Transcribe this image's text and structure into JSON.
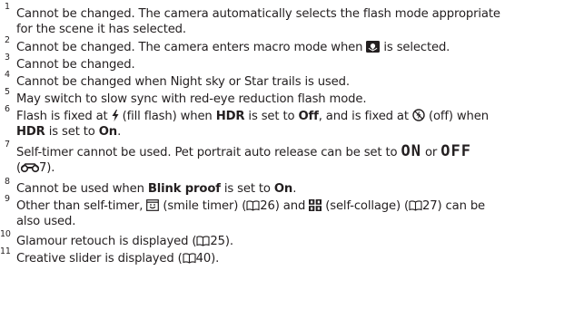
{
  "notes": [
    {
      "n": "1",
      "text": "Cannot be changed. The camera automatically selects the flash mode appropriate",
      "cont": "for the scene it has selected."
    },
    {
      "n": "2",
      "a": "Cannot be changed. The camera enters macro mode when ",
      "b": " is selected."
    },
    {
      "n": "3",
      "text": "Cannot be changed."
    },
    {
      "n": "4",
      "text": "Cannot be changed when Night sky or Star trails is used."
    },
    {
      "n": "5",
      "text": "May switch to slow sync with red-eye reduction flash mode."
    },
    {
      "n": "6",
      "a": "Flash is fixed at ",
      "b": " (fill flash) when ",
      "c": "HDR",
      "d": " is set to ",
      "e": "Off",
      "f": ", and is fixed at ",
      "g": " (off) when",
      "h": "HDR",
      "i": " is set to ",
      "j": "On",
      "k": "."
    },
    {
      "n": "7",
      "a": "Self-timer cannot be used. Pet portrait auto release can be set to ",
      "on": "ON",
      "or": " or ",
      "off": "OFF",
      "open": "(",
      "ref": "7",
      "close": ")."
    },
    {
      "n": "8",
      "a": "Cannot be used when ",
      "b": "Blink proof",
      "c": " is set to ",
      "d": "On",
      "e": "."
    },
    {
      "n": "9",
      "a": "Other than self-timer, ",
      "b": " (smile timer) (",
      "c": "26) and ",
      "d": " (self-collage) (",
      "e": "27) can be",
      "cont": "also used."
    },
    {
      "n": "10",
      "a": "Glamour retouch is displayed (",
      "b": "25)."
    },
    {
      "n": "11",
      "a": "Creative slider is displayed (",
      "b": "40)."
    }
  ],
  "icons": [
    "macro-scene-icon",
    "fill-flash-icon",
    "flash-off-icon",
    "reference-icon",
    "book-icon",
    "smile-timer-icon",
    "self-collage-icon"
  ]
}
